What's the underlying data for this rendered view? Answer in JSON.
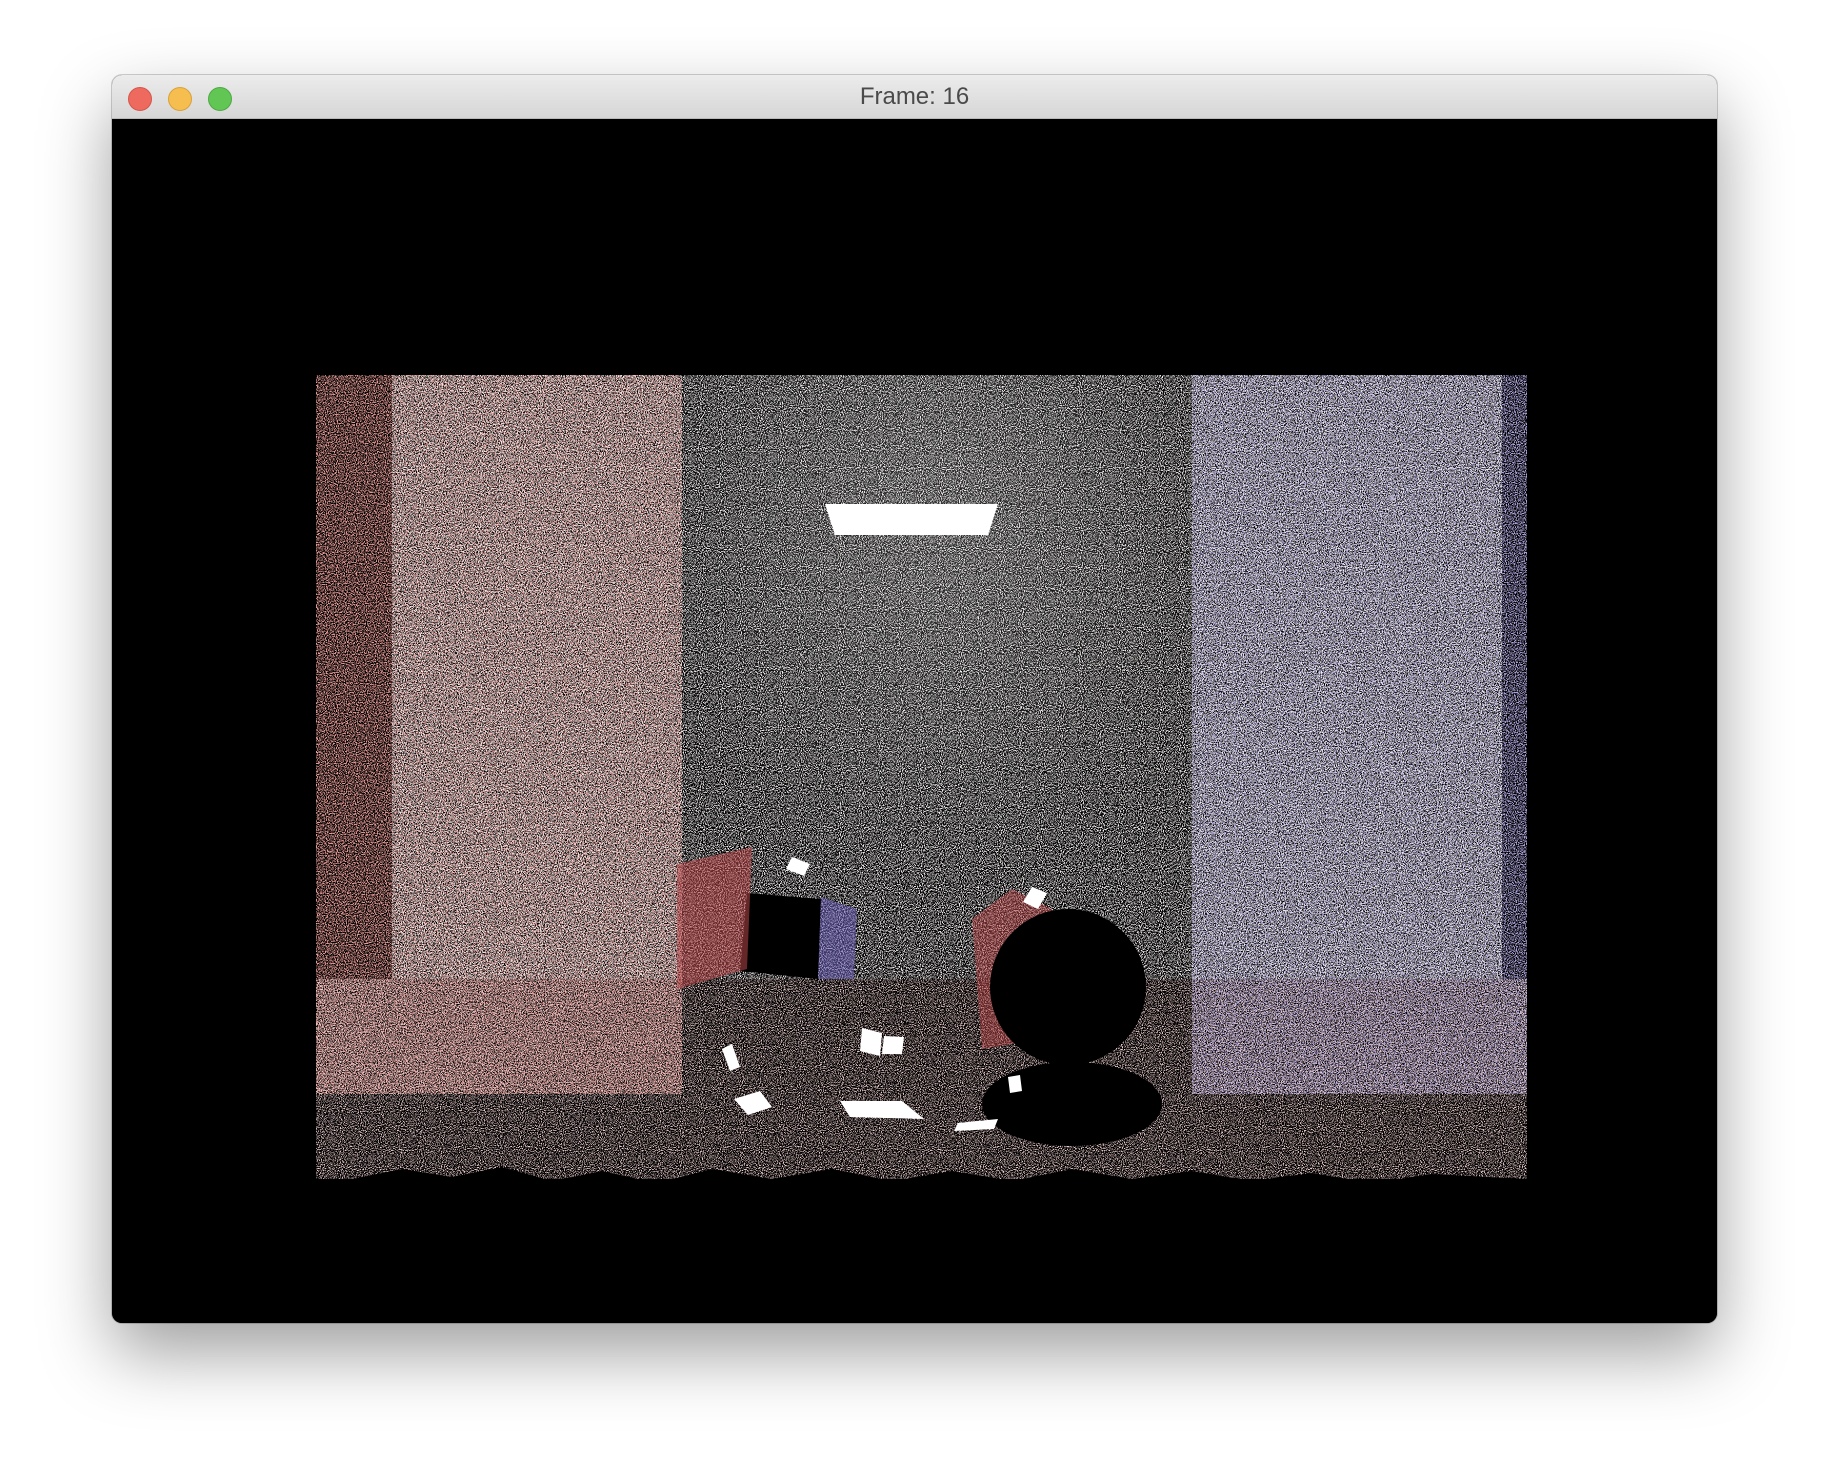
{
  "window": {
    "title": "Frame: 16"
  },
  "controls": {
    "close": "close-icon",
    "minimize": "minimize-icon",
    "maximize": "maximize-icon"
  },
  "colors": {
    "background": "#000000",
    "left_wall": "#c4524a",
    "right_wall": "#6a5fb8",
    "ceiling": "#d8cfcf",
    "light": "#ffffff",
    "close": "#ee6a5f",
    "minimize": "#f5be4f",
    "maximize": "#62c655"
  }
}
